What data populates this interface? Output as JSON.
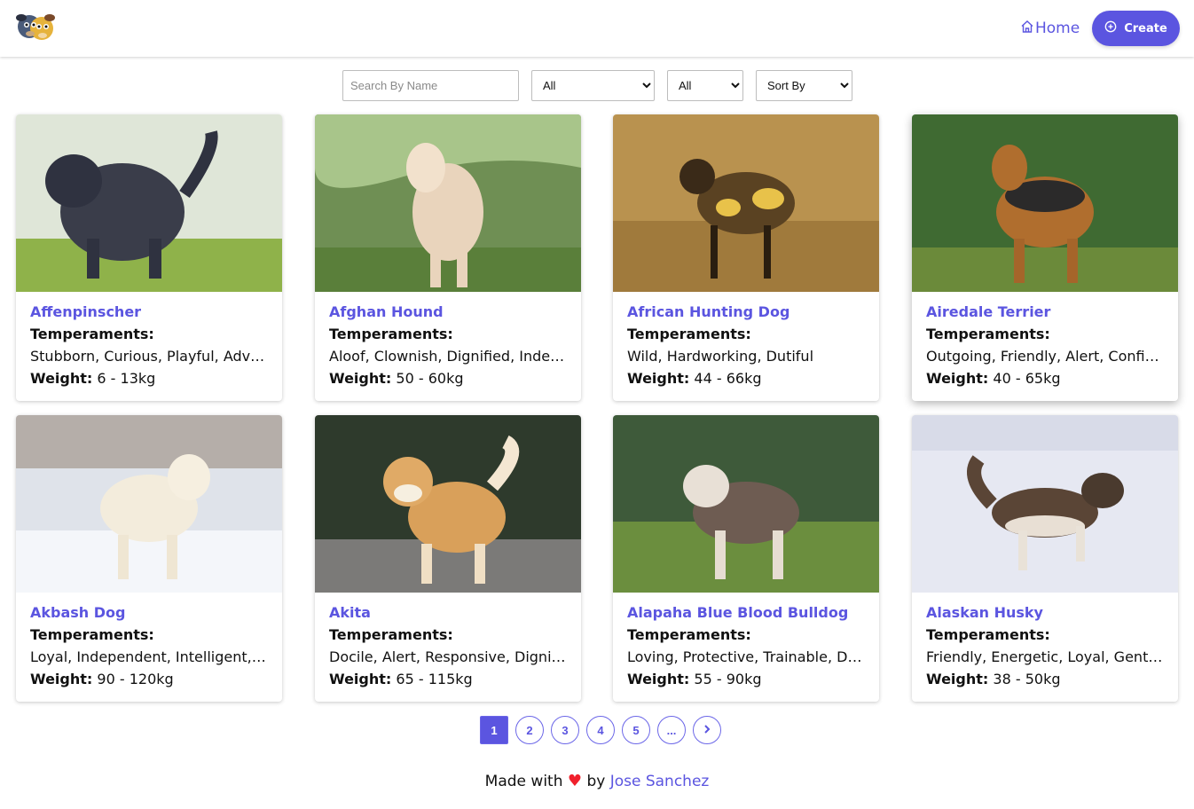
{
  "nav": {
    "home_label": "Home",
    "create_label": "Create"
  },
  "filters": {
    "search_placeholder": "Search By Name",
    "temperament_selected": "All",
    "origin_selected": "All",
    "sort_selected": "Sort By"
  },
  "labels": {
    "temperaments": "Temperaments:",
    "weight": "Weight:"
  },
  "cards": [
    {
      "name": "Affenpinscher",
      "temperaments": "Stubborn, Curious, Playful, Adventurous, Active, Fun-loving",
      "weight": "6 - 13kg"
    },
    {
      "name": "Afghan Hound",
      "temperaments": "Aloof, Clownish, Dignified, Independent, Happy",
      "weight": "50 - 60kg"
    },
    {
      "name": "African Hunting Dog",
      "temperaments": "Wild, Hardworking, Dutiful",
      "weight": "44 - 66kg"
    },
    {
      "name": "Airedale Terrier",
      "temperaments": "Outgoing, Friendly, Alert, Confident, Intelligent, Courageous",
      "weight": "40 - 65kg"
    },
    {
      "name": "Akbash Dog",
      "temperaments": "Loyal, Independent, Intelligent, Brave",
      "weight": "90 - 120kg"
    },
    {
      "name": "Akita",
      "temperaments": "Docile, Alert, Responsive, Dignified, Composed, Friendly",
      "weight": "65 - 115kg"
    },
    {
      "name": "Alapaha Blue Blood Bulldog",
      "temperaments": "Loving, Protective, Trainable, Dutiful, Responsible",
      "weight": "55 - 90kg"
    },
    {
      "name": "Alaskan Husky",
      "temperaments": "Friendly, Energetic, Loyal, Gentle, Confident",
      "weight": "38 - 50kg"
    }
  ],
  "pagination": {
    "pages": [
      "1",
      "2",
      "3",
      "4",
      "5",
      "..."
    ],
    "current": "1"
  },
  "footer": {
    "made_with": "Made with",
    "by": "by",
    "author": "Jose Sanchez"
  },
  "colors": {
    "accent": "#5b55e0",
    "heart": "#f0202c"
  }
}
